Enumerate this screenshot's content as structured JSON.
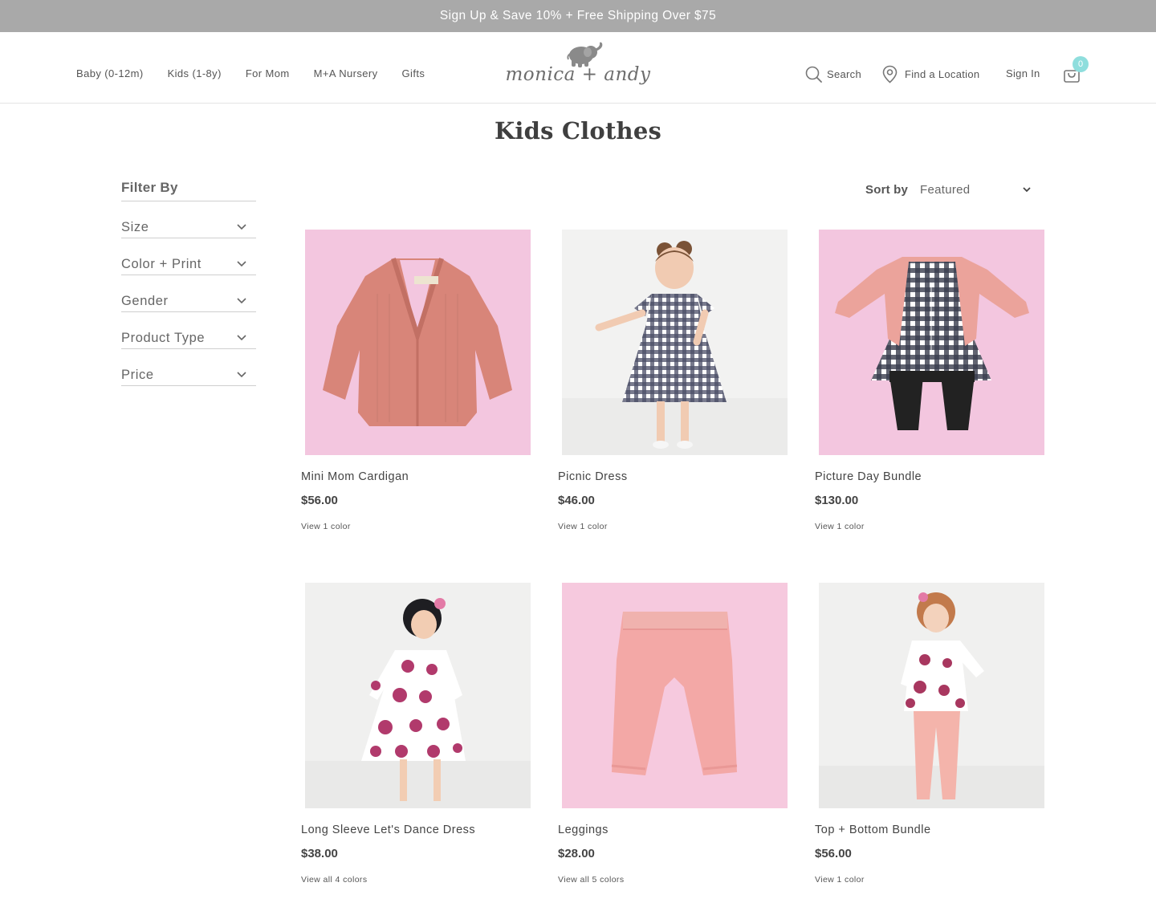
{
  "promo": {
    "text": "Sign Up & Save 10% + Free Shipping Over $75"
  },
  "nav": {
    "links": [
      "Baby (0-12m)",
      "Kids (1-8y)",
      "For Mom",
      "M+A Nursery",
      "Gifts"
    ],
    "logo_text": "monica + andy",
    "search_label": "Search",
    "location_label": "Find a Location",
    "signin_label": "Sign In",
    "cart_count": "0"
  },
  "page": {
    "title": "Kids Clothes"
  },
  "filters": {
    "heading": "Filter By",
    "items": [
      "Size",
      "Color + Print",
      "Gender",
      "Product Type",
      "Price"
    ]
  },
  "sort": {
    "label": "Sort by",
    "value": "Featured"
  },
  "products": [
    {
      "name": "Mini Mom Cardigan",
      "price": "$56.00",
      "colors": "View 1 color"
    },
    {
      "name": "Picnic Dress",
      "price": "$46.00",
      "colors": "View 1 color"
    },
    {
      "name": "Picture Day Bundle",
      "price": "$130.00",
      "colors": "View 1 color"
    },
    {
      "name": "Long Sleeve Let's Dance Dress",
      "price": "$38.00",
      "colors": "View all 4 colors"
    },
    {
      "name": "Leggings",
      "price": "$28.00",
      "colors": "View all 5 colors"
    },
    {
      "name": "Top + Bottom Bundle",
      "price": "$56.00",
      "colors": "View 1 color"
    }
  ],
  "colors": {
    "promo_bg": "#a9a9a9",
    "badge": "#8fdedd",
    "pink_bg": "#f3c6df",
    "white_bg": "#f4f4f4"
  }
}
